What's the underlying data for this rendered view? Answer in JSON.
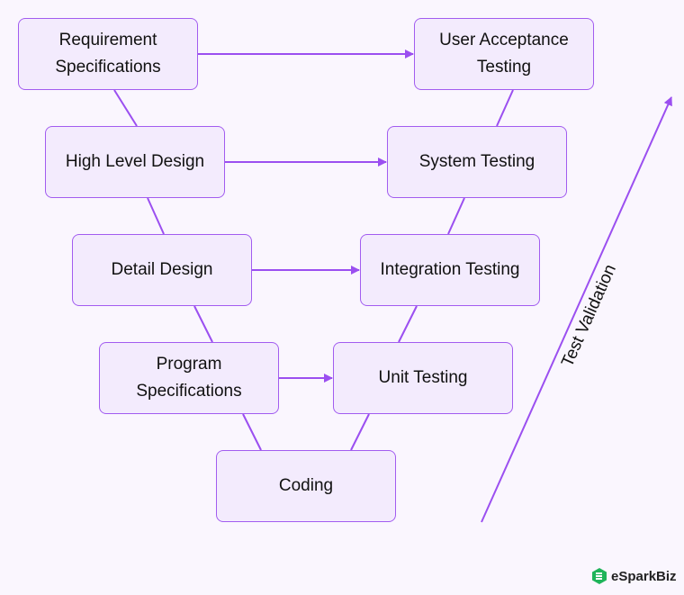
{
  "colors": {
    "accent": "#9b4ff0",
    "box_fill": "#f3ebfd",
    "background": "#faf6fe",
    "logo_green": "#1fb45a"
  },
  "boxes": {
    "requirement": "Requirement\nSpecifications",
    "high_level_design": "High Level Design",
    "detail_design": "Detail Design",
    "program_spec": "Program\nSpecifications",
    "coding": "Coding",
    "unit_testing": "Unit Testing",
    "integration_testing": "Integration Testing",
    "system_testing": "System Testing",
    "user_acceptance": "User Acceptance\nTesting"
  },
  "axis_label": "Test Validation",
  "logo": {
    "text": "eSparkBiz"
  }
}
